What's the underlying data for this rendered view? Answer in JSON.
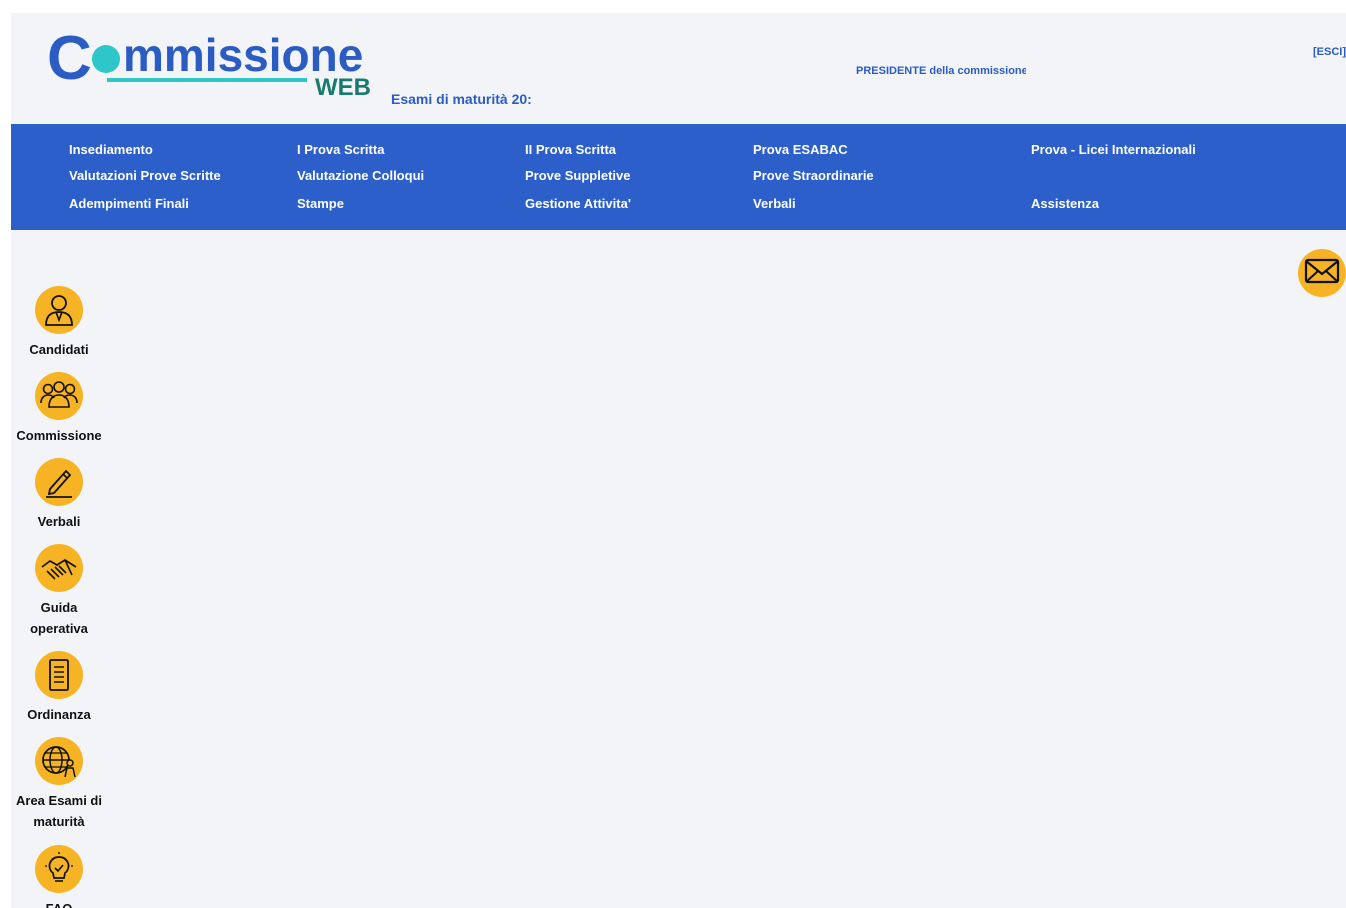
{
  "header": {
    "logo_main": "Commissione",
    "logo_sub": "WEB",
    "subtitle": "Esami di maturità 20:",
    "role_text": "PRESIDENTE della commissione l",
    "logout_label": "[ESCI]"
  },
  "nav": {
    "items": [
      "Insediamento",
      "I Prova Scritta",
      "II Prova Scritta",
      "Prova ESABAC",
      "Prova - Licei Internazionali",
      "Valutazioni Prove Scritte",
      "Valutazione Colloqui",
      "Prove Suppletive",
      "Prove Straordinarie",
      "Adempimenti Finali",
      "Stampe",
      "Gestione Attivita'",
      "Verbali",
      "Assistenza"
    ]
  },
  "sidebar": {
    "items": [
      {
        "label": "Candidati",
        "icon": "candidate-icon"
      },
      {
        "label": "Commissione",
        "icon": "group-icon"
      },
      {
        "label": "Verbali",
        "icon": "pencil-icon"
      },
      {
        "label": "Guida operativa",
        "icon": "handshake-icon"
      },
      {
        "label": "Ordinanza",
        "icon": "document-icon"
      },
      {
        "label": "Area Esami di maturità",
        "icon": "globe-person-icon"
      },
      {
        "label": "FAQ",
        "icon": "lightbulb-icon"
      }
    ]
  },
  "mail": {
    "icon": "envelope-icon"
  },
  "colors": {
    "nav_bg": "#2c5fc9",
    "accent_yellow": "#f6b324",
    "brand_blue": "#2b5cc4",
    "brand_teal": "#2ec7c9",
    "brand_dark_teal": "#1a7a6e",
    "page_bg": "#f2f4f7"
  }
}
